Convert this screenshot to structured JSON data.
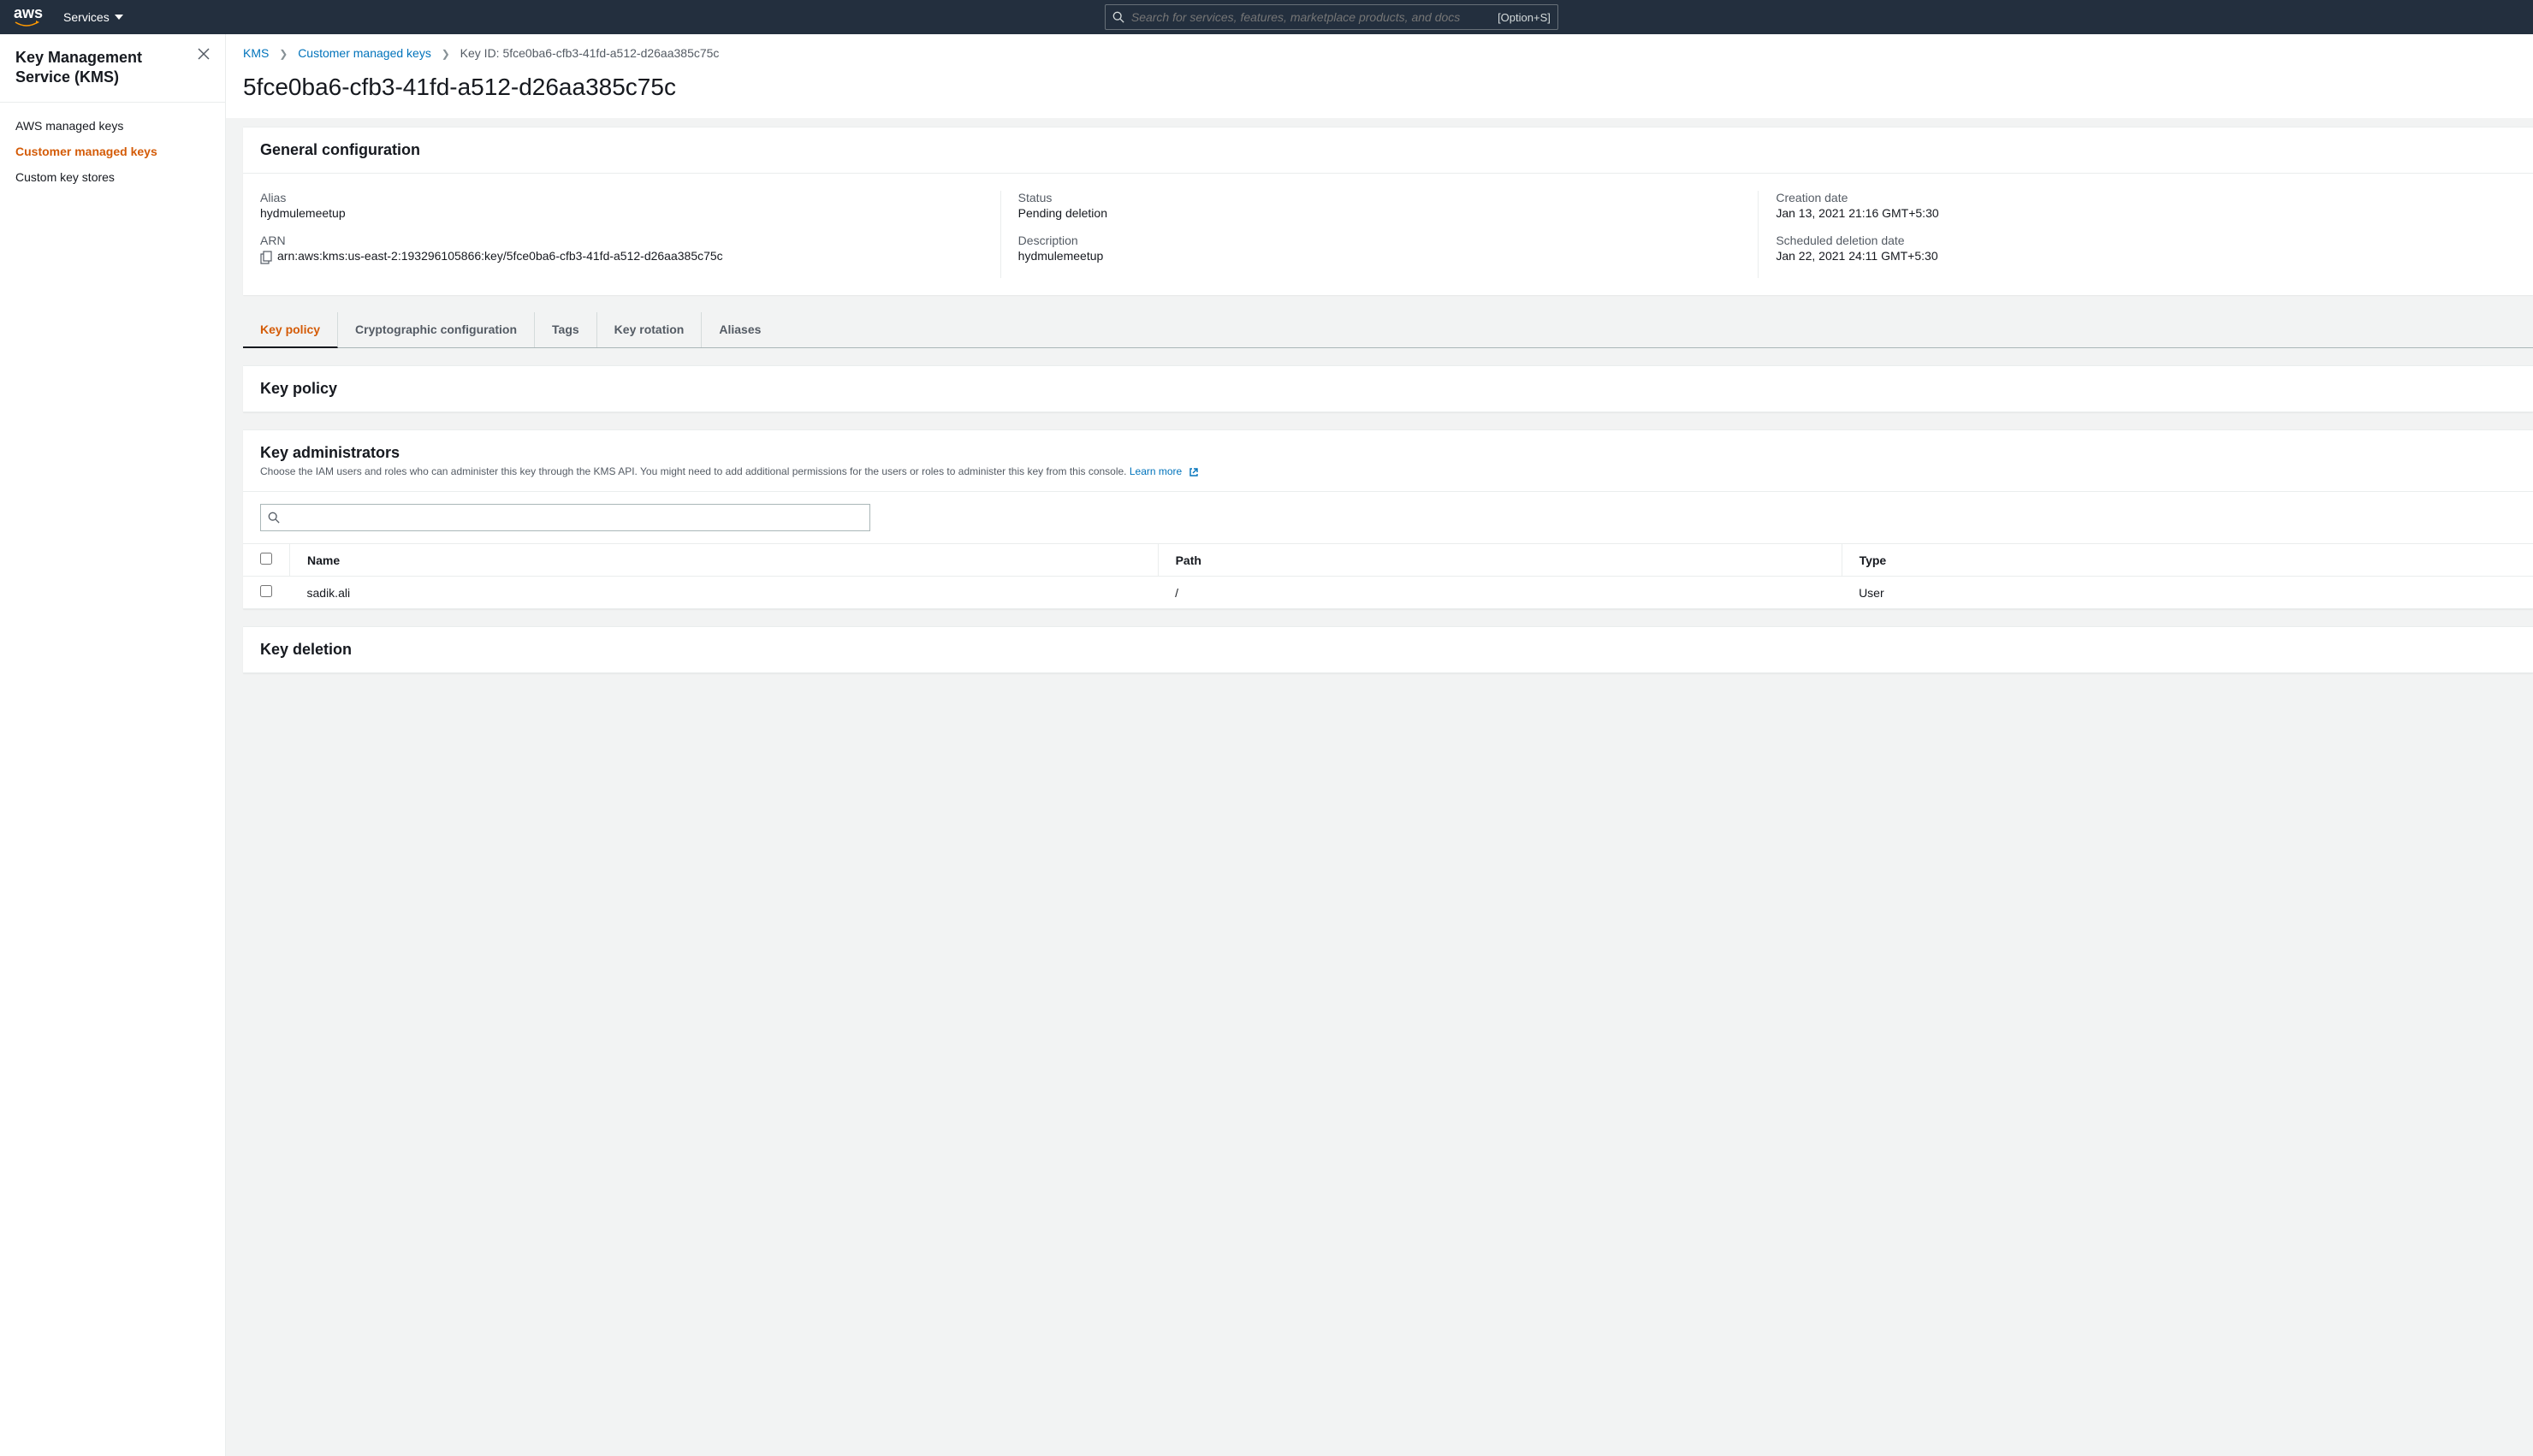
{
  "topnav": {
    "logo": "aws",
    "services": "Services",
    "search_placeholder": "Search for services, features, marketplace products, and docs",
    "search_shortcut": "[Option+S]"
  },
  "sidebar": {
    "title": "Key Management Service (KMS)",
    "items": [
      {
        "label": "AWS managed keys",
        "active": false
      },
      {
        "label": "Customer managed keys",
        "active": true
      },
      {
        "label": "Custom key stores",
        "active": false
      }
    ]
  },
  "breadcrumb": {
    "root": "KMS",
    "section": "Customer managed keys",
    "current": "Key ID: 5fce0ba6-cfb3-41fd-a512-d26aa385c75c"
  },
  "page_title": "5fce0ba6-cfb3-41fd-a512-d26aa385c75c",
  "general": {
    "heading": "General configuration",
    "alias_label": "Alias",
    "alias_value": "hydmulemeetup",
    "arn_label": "ARN",
    "arn_value": "arn:aws:kms:us-east-2:193296105866:key/5fce0ba6-cfb3-41fd-a512-d26aa385c75c",
    "status_label": "Status",
    "status_value": "Pending deletion",
    "description_label": "Description",
    "description_value": "hydmulemeetup",
    "creation_label": "Creation date",
    "creation_value": "Jan 13, 2021 21:16 GMT+5:30",
    "deletion_label": "Scheduled deletion date",
    "deletion_value": "Jan 22, 2021 24:11 GMT+5:30"
  },
  "tabs": [
    {
      "label": "Key policy",
      "active": true
    },
    {
      "label": "Cryptographic configuration",
      "active": false
    },
    {
      "label": "Tags",
      "active": false
    },
    {
      "label": "Key rotation",
      "active": false
    },
    {
      "label": "Aliases",
      "active": false
    }
  ],
  "key_policy": {
    "heading": "Key policy"
  },
  "key_admins": {
    "heading": "Key administrators",
    "subtitle": "Choose the IAM users and roles who can administer this key through the KMS API. You might need to add additional permissions for the users or roles to administer this key from this console. ",
    "learn_more": "Learn more",
    "columns": {
      "name": "Name",
      "path": "Path",
      "type": "Type"
    },
    "rows": [
      {
        "name": "sadik.ali",
        "path": "/",
        "type": "User"
      }
    ]
  },
  "key_deletion": {
    "heading": "Key deletion"
  }
}
